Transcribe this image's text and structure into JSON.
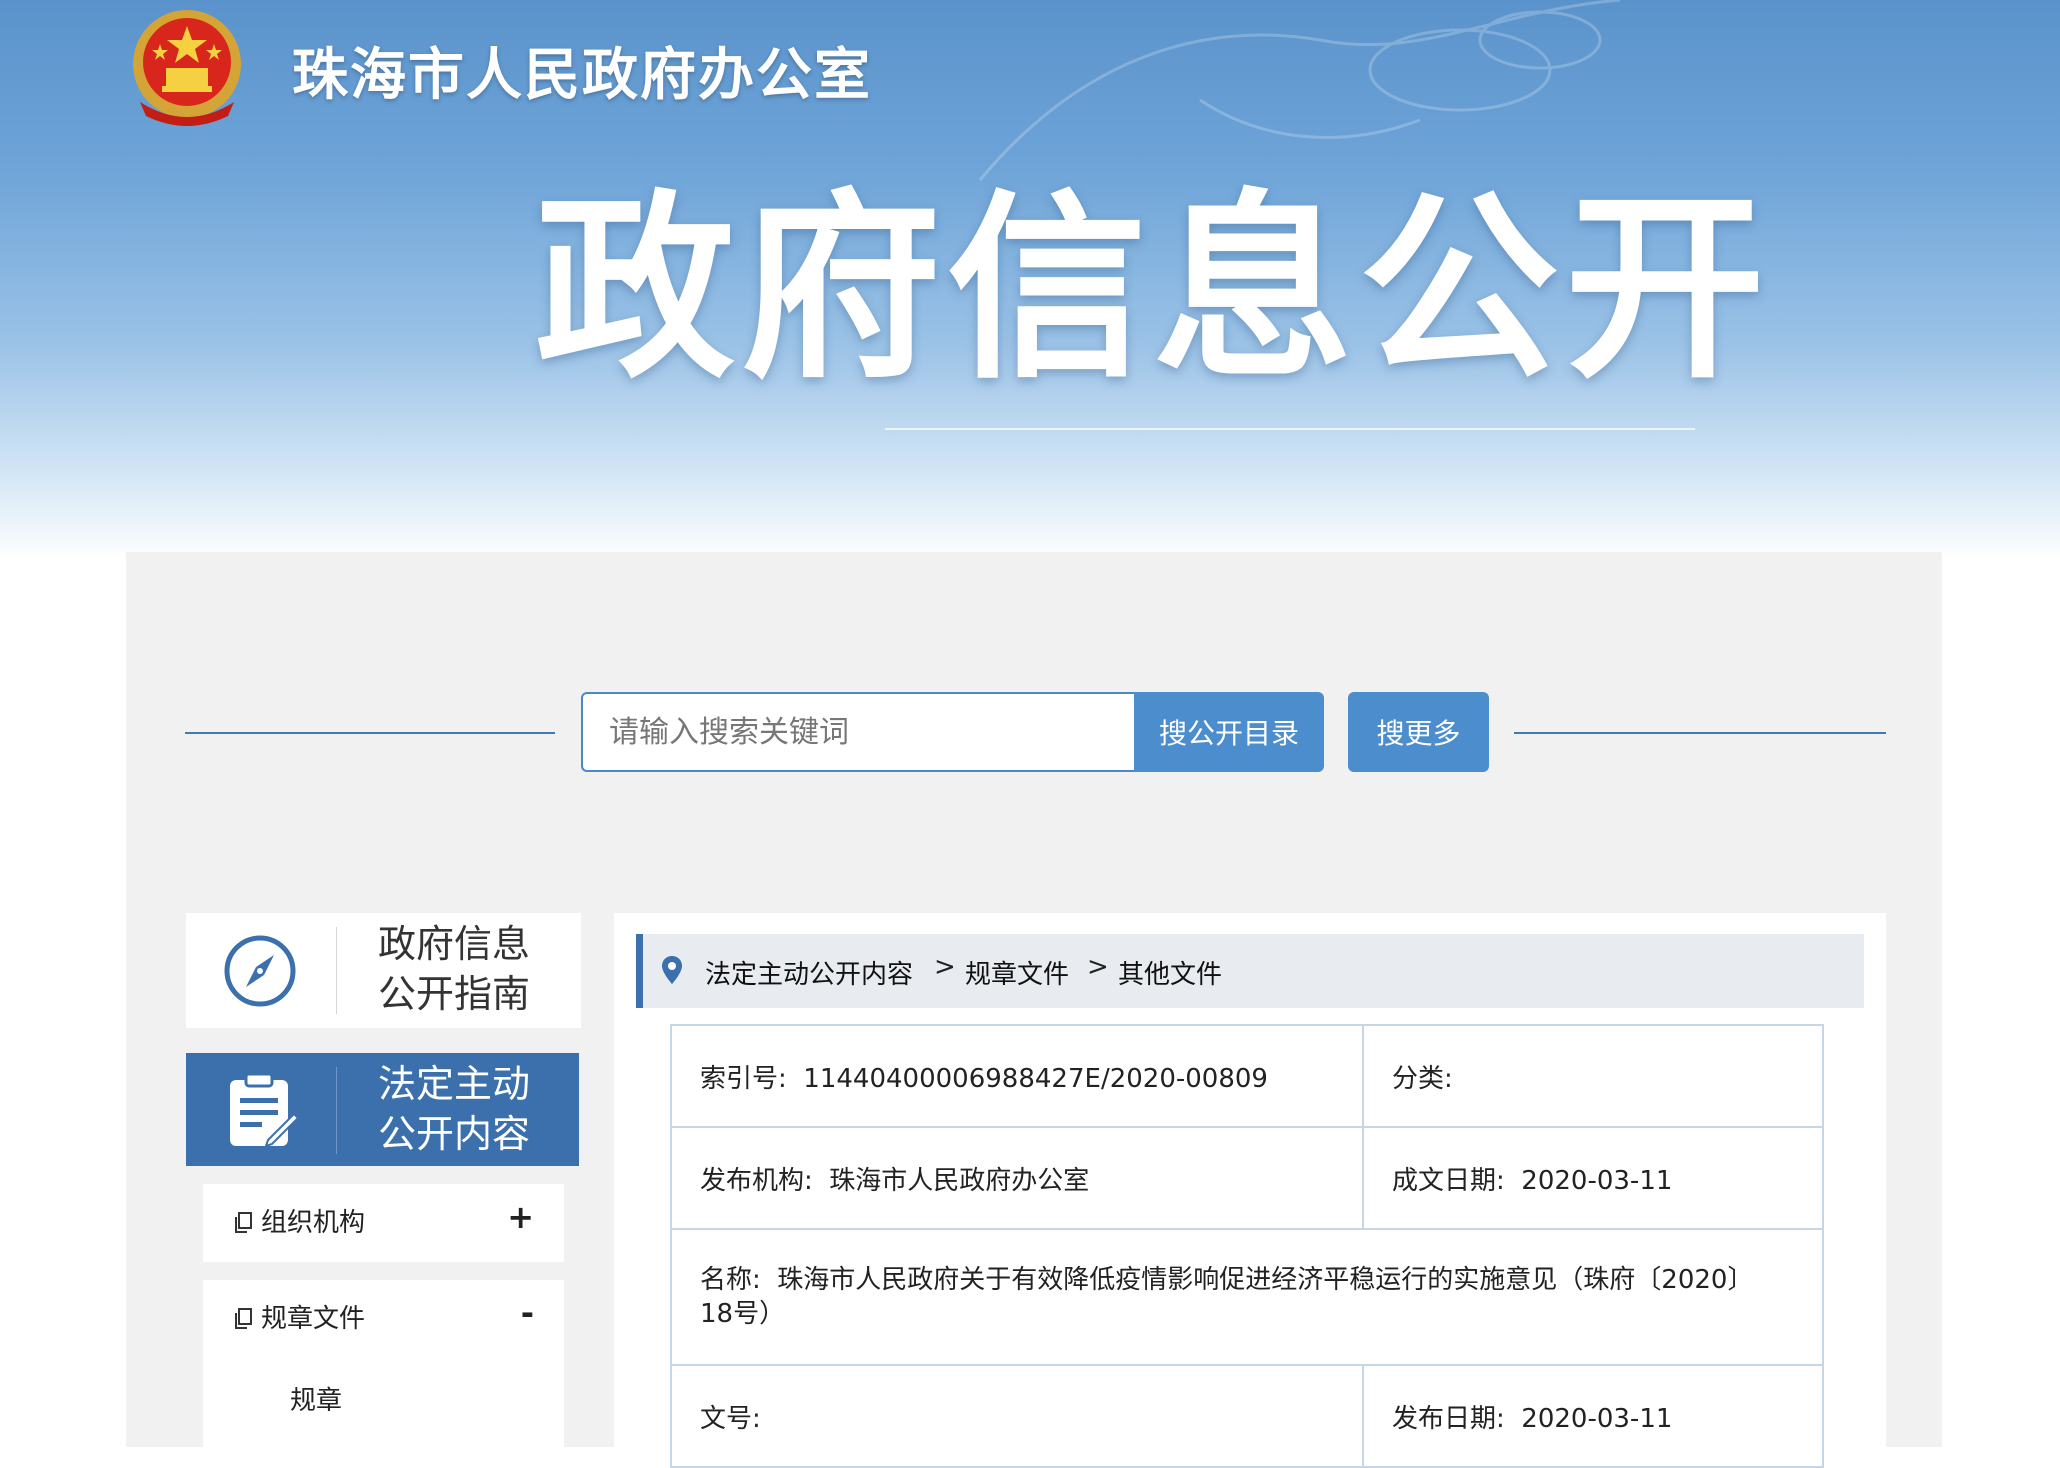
{
  "header": {
    "org_name": "珠海市人民政府办公室",
    "hero_title": "政府信息公开"
  },
  "search": {
    "placeholder": "请输入搜索关键词",
    "catalog_button": "搜公开目录",
    "more_button": "搜更多"
  },
  "sidebar": {
    "guide_label_line1": "政府信息",
    "guide_label_line2": "公开指南",
    "active_label_line1": "法定主动",
    "active_label_line2": "公开内容",
    "items": [
      {
        "label": "组织机构",
        "toggle": "+"
      },
      {
        "label": "规章文件",
        "toggle": "-"
      }
    ],
    "sub_items": [
      "规章"
    ]
  },
  "breadcrumb": [
    "法定主动公开内容",
    "规章文件",
    "其他文件"
  ],
  "breadcrumb_separator": ">",
  "document": {
    "index_label": "索引号:",
    "index_value": "11440400006988427E/2020-00809",
    "category_label": "分类:",
    "category_value": "",
    "publisher_label": "发布机构:",
    "publisher_value": "珠海市人民政府办公室",
    "created_label": "成文日期:",
    "created_value": "2020-03-11",
    "name_label": "名称:",
    "name_value": "珠海市人民政府关于有效降低疫情影响促进经济平稳运行的实施意见（珠府〔2020〕18号）",
    "docnum_label": "文号:",
    "docnum_value": "",
    "published_label": "发布日期:",
    "published_value": "2020-03-11"
  },
  "colors": {
    "accent": "#4c8dcd",
    "active_nav": "#3b70ad",
    "banner_top": "#5a93cb",
    "table_border": "#c5d6e6"
  },
  "icons": {
    "emblem": "national-emblem-icon",
    "guide": "compass-icon",
    "active": "clipboard-edit-icon",
    "item": "document-copy-icon",
    "breadcrumb": "location-pin-icon"
  }
}
